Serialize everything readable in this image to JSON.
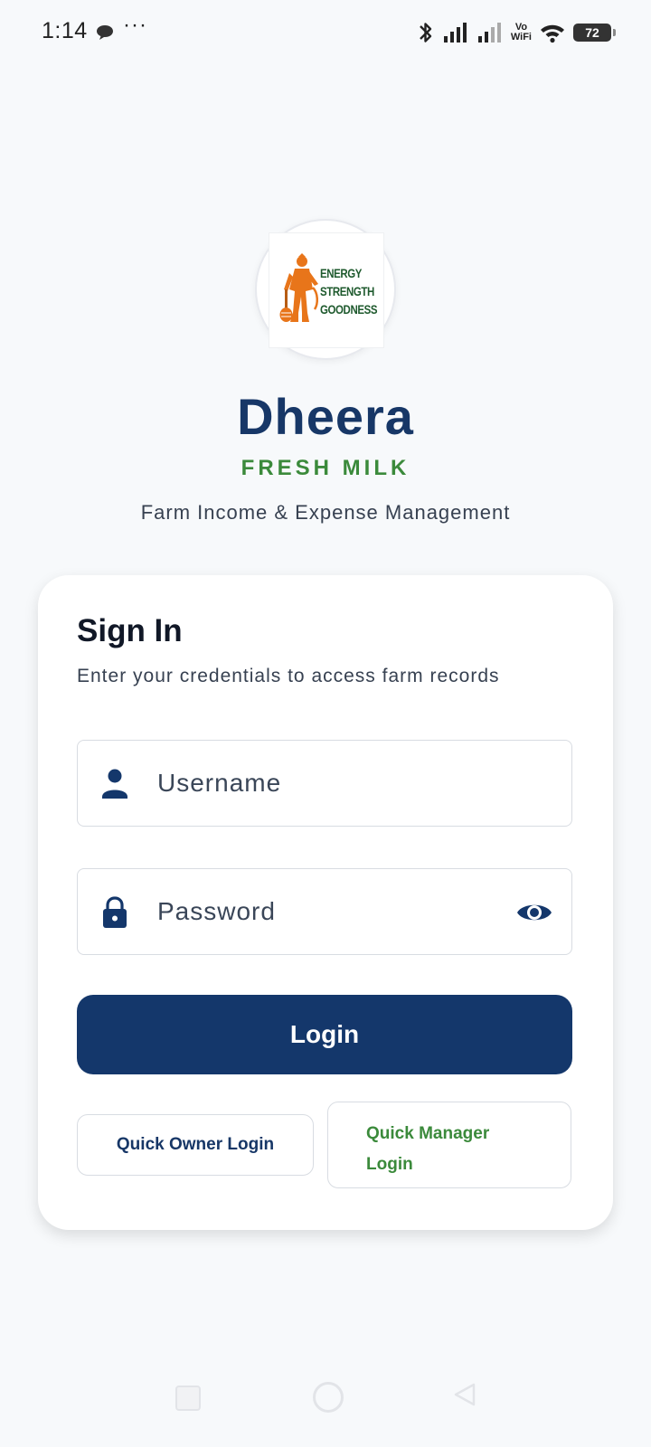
{
  "status_bar": {
    "time": "1:14",
    "more": "···",
    "network_label_top": "Vo",
    "network_label_bottom": "WiFi",
    "battery": "72",
    "icons": [
      "message-icon",
      "bluetooth-icon",
      "signal-icon",
      "signal-icon",
      "wifi-icon",
      "battery-icon"
    ]
  },
  "logo": {
    "line1": "ENERGY",
    "line2": "STRENGTH",
    "line3": "GOODNESS"
  },
  "brand": {
    "name": "Dheera",
    "subtitle": "FRESH MILK",
    "tagline": "Farm Income & Expense Management"
  },
  "login_card": {
    "title": "Sign In",
    "subtitle": "Enter your credentials to access farm records",
    "username": {
      "value": "",
      "placeholder": "Username",
      "icon": "person-icon"
    },
    "password": {
      "value": "",
      "placeholder": "Password",
      "icon": "lock-icon",
      "toggle_icon": "eye-icon"
    },
    "login_label": "Login",
    "quick_owner_label": "Quick Owner Login",
    "quick_manager_line1": "Quick Manager",
    "quick_manager_line2": "Login"
  },
  "colors": {
    "primary": "#14376b",
    "accent_green": "#3b8a3b",
    "background": "#f7f9fb"
  }
}
